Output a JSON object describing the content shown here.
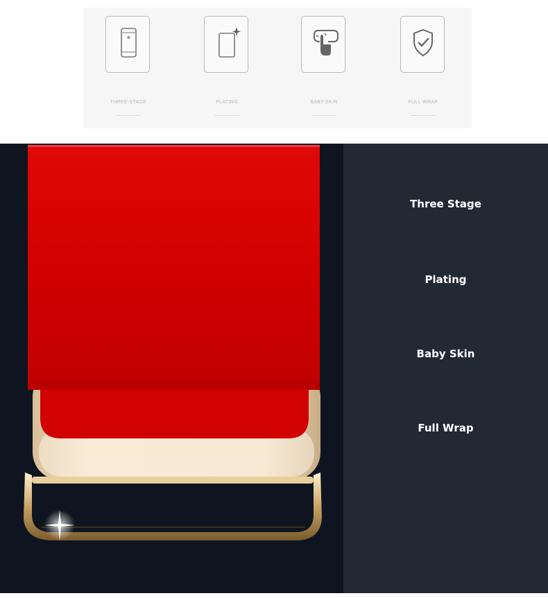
{
  "feature_strip": {
    "items": [
      {
        "label": "THREE-STAGE",
        "icon": "phone-icon"
      },
      {
        "label": "PLATING",
        "icon": "sparkle-card-icon"
      },
      {
        "label": "BABY-SKIN",
        "icon": "touch-hand-icon"
      },
      {
        "label": "FULL WRAP",
        "icon": "shield-check-icon"
      }
    ]
  },
  "features_panel": {
    "items": [
      {
        "title": "Three Stage"
      },
      {
        "title": "Plating"
      },
      {
        "title": "Baby Skin"
      },
      {
        "title": "Full Wrap"
      }
    ]
  },
  "colors": {
    "case_red": "#d40000",
    "case_gold": "#e8d3b0",
    "panel_dark": "#232835",
    "background_dark": "#0f1520"
  }
}
